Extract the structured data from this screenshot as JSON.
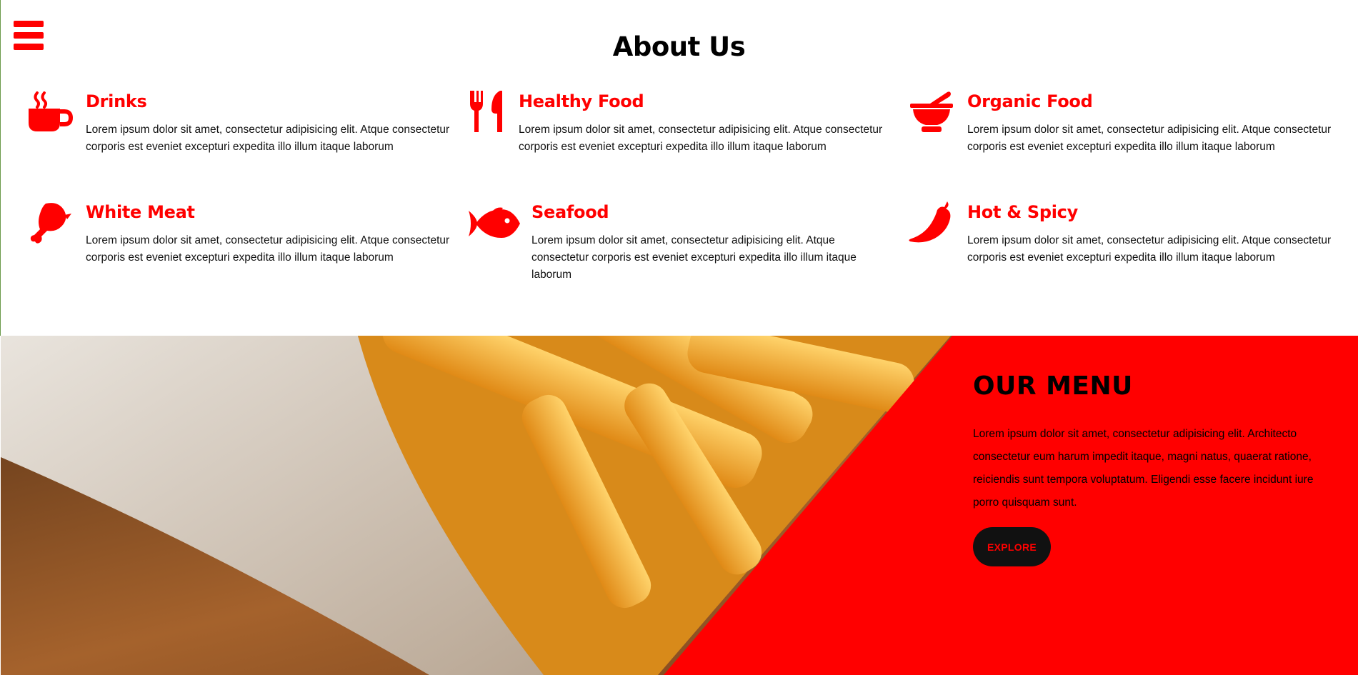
{
  "nav": {
    "menu_icon": "hamburger-icon"
  },
  "about": {
    "title": "About Us",
    "features": [
      {
        "icon": "coffee-cup-icon",
        "title": "Drinks",
        "text": "Lorem ipsum dolor sit amet, consectetur adipisicing elit. Atque consectetur corporis est eveniet excepturi expedita illo illum itaque laborum"
      },
      {
        "icon": "fork-knife-icon",
        "title": "Healthy Food",
        "text": "Lorem ipsum dolor sit amet, consectetur adipisicing elit. Atque consectetur corporis est eveniet excepturi expedita illo illum itaque laborum"
      },
      {
        "icon": "mortar-pestle-icon",
        "title": "Organic Food",
        "text": "Lorem ipsum dolor sit amet, consectetur adipisicing elit. Atque consectetur corporis est eveniet excepturi expedita illo illum itaque laborum"
      },
      {
        "icon": "drumstick-icon",
        "title": "White Meat",
        "text": "Lorem ipsum dolor sit amet, consectetur adipisicing elit. Atque consectetur corporis est eveniet excepturi expedita illo illum itaque laborum"
      },
      {
        "icon": "fish-icon",
        "title": "Seafood",
        "text": "Lorem ipsum dolor sit amet, consectetur adipisicing elit. Atque consectetur corporis est eveniet excepturi expedita illo illum itaque laborum"
      },
      {
        "icon": "chili-pepper-icon",
        "title": "Hot & Spicy",
        "text": "Lorem ipsum dolor sit amet, consectetur adipisicing elit. Atque consectetur corporis est eveniet excepturi expedita illo illum itaque laborum"
      }
    ]
  },
  "menu_section": {
    "title": "OUR MENU",
    "text": "Lorem ipsum dolor sit amet, consectetur adipisicing elit. Architecto consectetur eum harum impedit itaque, magni natus, quaerat ratione, reiciendis sunt tempora voluptatum. Eligendi esse facere incidunt iure porro quisquam sunt.",
    "button_label": "EXPLORE"
  },
  "colors": {
    "accent": "#ff0000",
    "button_bg": "#111111",
    "text": "#000000"
  }
}
